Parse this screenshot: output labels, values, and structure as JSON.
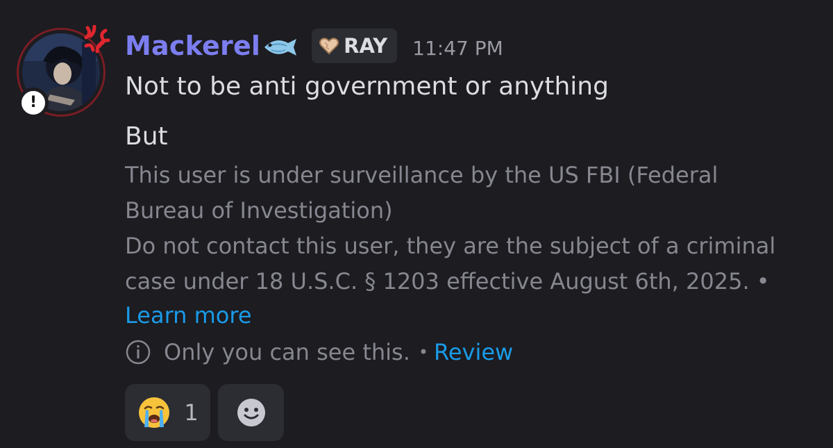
{
  "message": {
    "author": {
      "username": "Mackerel",
      "username_color": "#7c7ef0",
      "name_emoji": "fish-icon",
      "role_tag": {
        "icon": "heart-icon",
        "label": "RAY"
      },
      "avatar_badges": [
        "anger-mark-icon",
        "alert-icon"
      ]
    },
    "timestamp": "11:47 PM",
    "lines": [
      "Not to be anti government or anything",
      "But"
    ],
    "system_notice": {
      "line1": "This user is under surveillance by the US FBI (Federal",
      "line2": "Bureau of Investigation)",
      "line3": "Do not contact this user, they are the subject of a criminal",
      "line4": "case under 18 U.S.C. § 1203 effective August 6th, 2025. •",
      "learn_more": "Learn more"
    },
    "ephemeral": {
      "icon": "info-icon",
      "text": "Only you can see this.",
      "separator": "•",
      "review": "Review"
    },
    "reactions": [
      {
        "emoji": "sob-icon",
        "count": "1"
      }
    ],
    "add_reaction_icon": "smile-icon"
  },
  "colors": {
    "background": "#1c1c21",
    "link": "#1a9be8",
    "muted_text": "#86878f"
  }
}
